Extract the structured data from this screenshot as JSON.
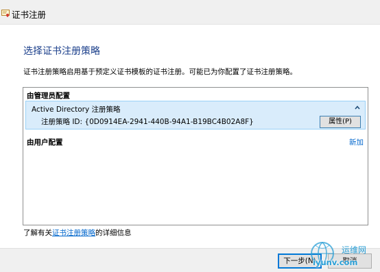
{
  "window": {
    "title": "证书注册",
    "icon": "certificate-icon"
  },
  "page": {
    "heading": "选择证书注册策略",
    "description": "证书注册策略启用基于预定义证书模板的证书注册。可能已为你配置了证书注册策略。"
  },
  "policies": {
    "admin_group_label": "由管理员配置",
    "user_group_label": "由用户配置",
    "add_link": "新加",
    "items": [
      {
        "name": "Active Directory 注册策略",
        "id_line": "注册策略 ID:  {0D0914EA-2941-440B-94A1-B19BC4B02A8F}",
        "properties_label": "属性(P)",
        "collapse_icon": "chevron-up-icon"
      }
    ]
  },
  "more_info": {
    "prefix": "了解有关",
    "link": "证书注册策略",
    "suffix": "的详细信息"
  },
  "footer": {
    "next_label": "下一步(N)",
    "cancel_label": "取消"
  },
  "watermark": {
    "name": "运维网",
    "url": "iyunv.com",
    "icon": "watermark-logo-icon"
  },
  "colors": {
    "heading": "#1b3f8b",
    "link": "#0066cc",
    "selection_bg": "#d9ecfb",
    "selection_border": "#99d1f7"
  }
}
